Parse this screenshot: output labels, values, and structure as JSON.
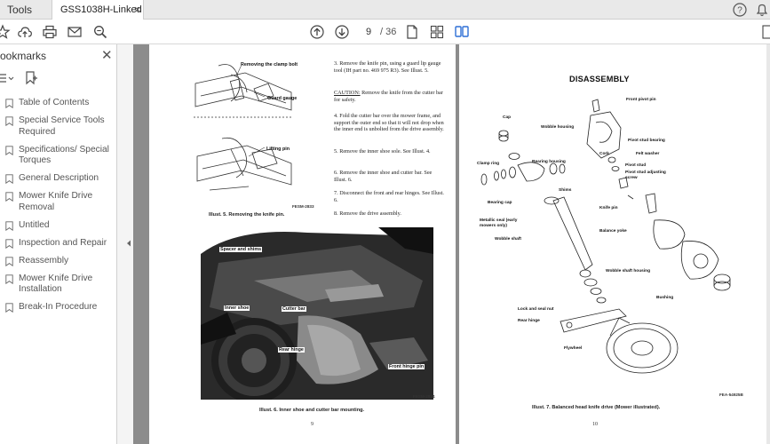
{
  "tabs": {
    "tools_label": "Tools",
    "doc_label": "GSS1038H-Linked p...",
    "close_glyph": "×"
  },
  "toolbar": {
    "page_current": "9",
    "page_total": "/ 36"
  },
  "sidebar": {
    "title": "ookmarks",
    "close_glyph": "✕",
    "items": [
      {
        "label": "Table of Contents"
      },
      {
        "label": "Special Service Tools Required"
      },
      {
        "label": "Specifications/ Special Torques"
      },
      {
        "label": "General Description"
      },
      {
        "label": "Mower Knife Drive Removal"
      },
      {
        "label": "Untitled"
      },
      {
        "label": "Inspection and Repair"
      },
      {
        "label": "Reassembly"
      },
      {
        "label": "Mower Knife Drive Installation"
      },
      {
        "label": "Break-In Procedure"
      }
    ]
  },
  "page_left": {
    "callouts_top": {
      "clamp_bolt": "Removing the clamp bolt",
      "guard_gauge": "Guard gauge",
      "lifting_pin": "Lifting pin",
      "code": "FESM-2833"
    },
    "caption5": "Illust. 5.  Removing the knife pin.",
    "steps": [
      "3.  Remove the knife pin, using a guard lip gauge tool (IH part no. 469 975 R3). See Illust. 5.",
      "4.  Fold the cutter bar over the mower frame, and support the outer end so that it will not drop when the inner end is unbolted from the drive assembly.",
      "5.  Remove the inner shoe sole.  See Illust. 4.",
      "6.  Remove the inner shoe and cutter bar.  See Illust. 6.",
      "7.  Disconnect the front and rear hinges.  See Illust. 6.",
      "8.  Remove the drive assembly."
    ],
    "caution_label": "CAUTION:",
    "caution_text": "Remove the knife from the cutter bar for safety.",
    "photo_labels": {
      "spacer": "Spacer and shims",
      "inner_shoe": "Inner shoe",
      "cutter_bar": "Cutter bar",
      "rear_hinge": "Rear hinge",
      "front_hinge": "Front hinge pin",
      "code": "FESM-2834"
    },
    "caption6": "Illust. 6.  Inner shoe and cutter bar mounting.",
    "page_number": "9"
  },
  "page_right": {
    "heading": "DISASSEMBLY",
    "labels": {
      "front_pivot_pin": "Front pivot pin",
      "cap": "Cap",
      "wobble_housing": "Wobble housing",
      "pivot_stud_bearing": "Pivot stud bearing",
      "cork": "Cork",
      "felt_washer": "Felt washer",
      "pivot_stud": "Pivot stud",
      "pivot_stud_adj": "Pivot stud adjusting screw",
      "clamp_ring": "Clamp ring",
      "bearing_housing": "Bearing housing",
      "shims": "Shims",
      "bearing_cap": "Bearing cap",
      "knife_pin": "Knife pin",
      "metallic_seal": "Metallic seal (early mowers only)",
      "balance_yoke": "Balance yoke",
      "wobble_shaft": "Wobble shaft",
      "wobble_shaft_housing": "Wobble shaft housing",
      "bushing": "Bushing",
      "lock_seal_nut": "Lock and seal nut",
      "rear_hinge": "Rear hinge",
      "flywheel": "Flywheel",
      "code": "FEA-54925B"
    },
    "caption7": "Illust. 7.  Balanced head knife drive (Mower illustrated).",
    "page_number": "10"
  }
}
